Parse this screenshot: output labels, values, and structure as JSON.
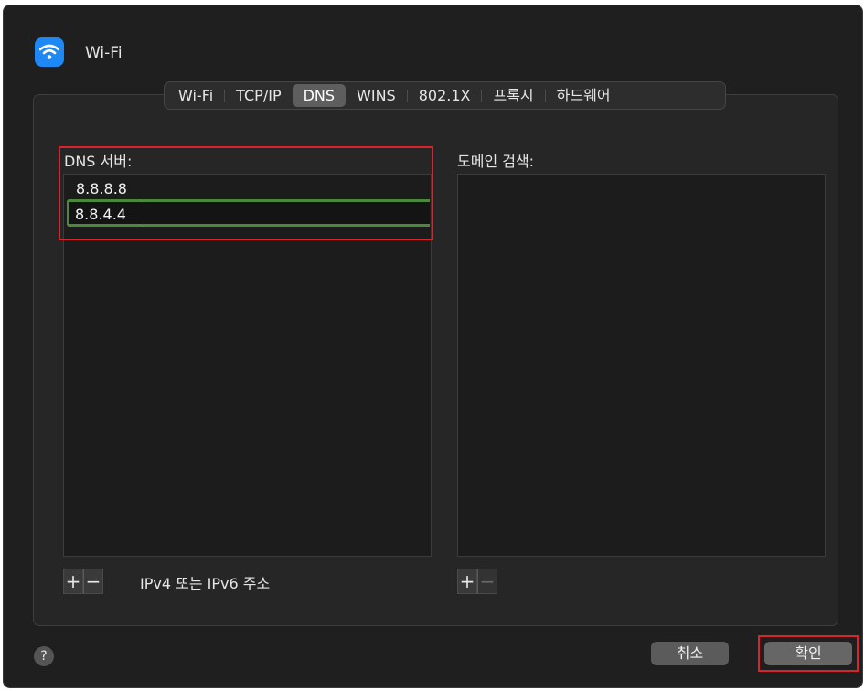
{
  "window": {
    "title": "Wi-Fi",
    "icon": "wifi-icon"
  },
  "tabs": [
    {
      "label": "Wi-Fi",
      "active": false
    },
    {
      "label": "TCP/IP",
      "active": false
    },
    {
      "label": "DNS",
      "active": true
    },
    {
      "label": "WINS",
      "active": false
    },
    {
      "label": "802.1X",
      "active": false
    },
    {
      "label": "프록시",
      "active": false
    },
    {
      "label": "하드웨어",
      "active": false
    }
  ],
  "dns": {
    "label": "DNS 서버:",
    "servers": [
      "8.8.8.8"
    ],
    "editing_value": "8.8.4.4",
    "add_label": "+",
    "remove_label": "−",
    "hint": "IPv4 또는 IPv6 주소"
  },
  "domain": {
    "label": "도메인 검색:",
    "add_label": "+",
    "remove_label": "−"
  },
  "footer": {
    "help_label": "?",
    "cancel_label": "취소",
    "ok_label": "확인"
  },
  "colors": {
    "highlight_red": "#d9232d",
    "edit_focus_green": "#4b8a3a",
    "wifi_blue": "#1e88f5"
  }
}
